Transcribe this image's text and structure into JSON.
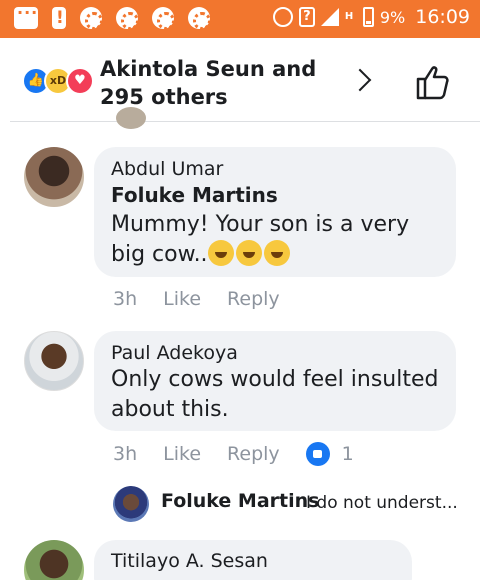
{
  "status_bar": {
    "battery": "9%",
    "time": "16:09",
    "network": "H"
  },
  "reactions_header": {
    "summary": "Akintola Seun and 295 others",
    "reaction_icons": [
      "like-icon",
      "haha-icon",
      "love-icon"
    ]
  },
  "comments": [
    {
      "author": "Abdul Umar",
      "tagged": "Foluke Martins",
      "text": "Mummy! Your son is a very big cow..",
      "emojis": [
        "sweat-smile-emoji",
        "laughing-emoji",
        "smile-emoji"
      ],
      "time": "3h",
      "like_label": "Like",
      "reply_label": "Reply"
    },
    {
      "author": "Paul Adekoya",
      "text": "Only cows would feel insulted about this.",
      "time": "3h",
      "like_label": "Like",
      "reply_label": "Reply",
      "like_count": "1",
      "reply_preview": {
        "author": "Foluke Martins",
        "text": "I do not underst..."
      }
    },
    {
      "author": "Titilayo A. Sesan"
    }
  ],
  "colors": {
    "status_bar": "#f2762e",
    "like_blue": "#1877f2",
    "bubble_bg": "#f0f2f5",
    "meta_text": "#8d949e"
  }
}
